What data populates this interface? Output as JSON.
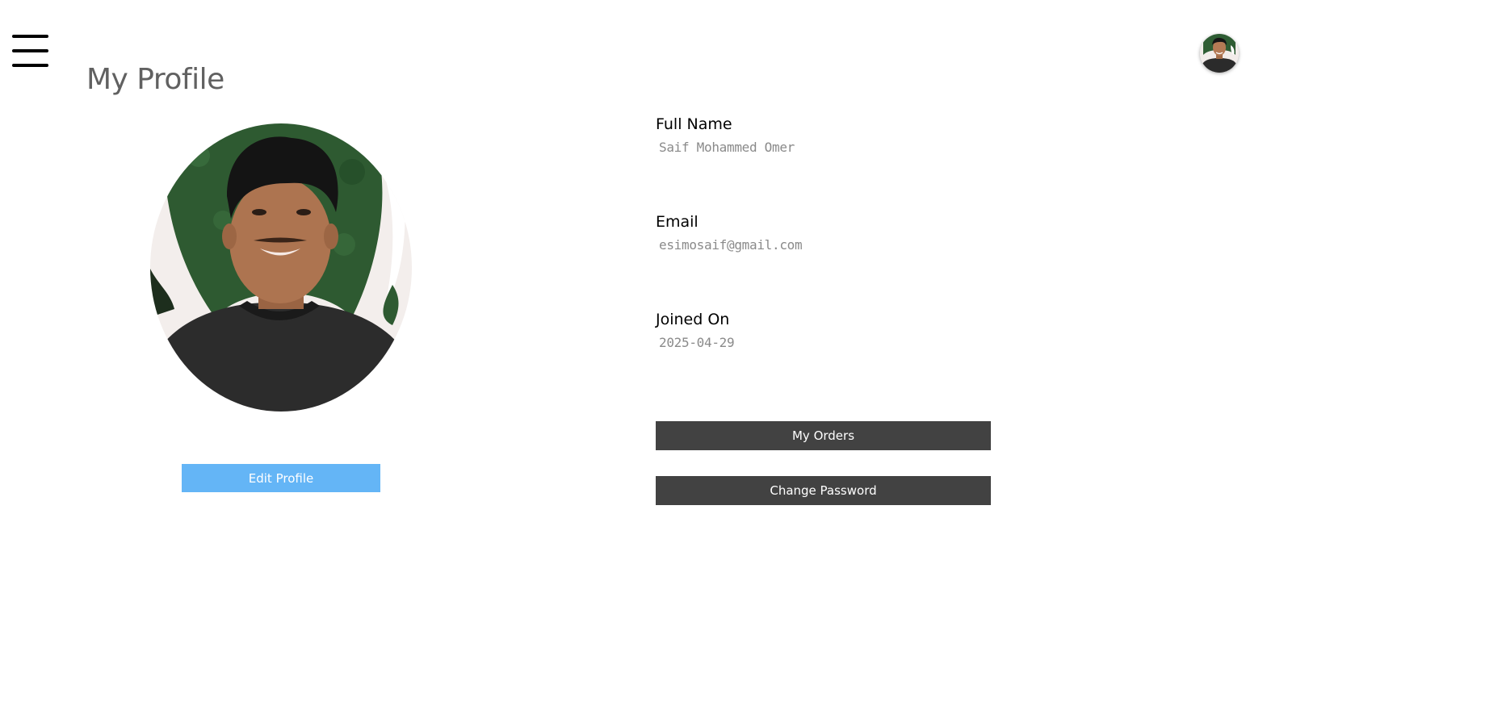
{
  "header": {
    "menu_icon": "hamburger-menu-icon",
    "user_avatar": "user-avatar"
  },
  "page": {
    "title": "My Profile"
  },
  "profile": {
    "photo": "profile-photo",
    "edit_button": "Edit Profile",
    "fields": [
      {
        "label": "Full Name",
        "value": "Saif Mohammed Omer"
      },
      {
        "label": "Email",
        "value": "esimosaif@gmail.com"
      },
      {
        "label": "Joined On",
        "value": "2025-04-29"
      }
    ],
    "actions": {
      "orders": "My Orders",
      "change_password": "Change Password"
    }
  },
  "colors": {
    "edit_button_bg": "#64b5f6",
    "action_button_bg": "#424242",
    "title_text": "#616161",
    "value_text": "#8a8a8a"
  }
}
